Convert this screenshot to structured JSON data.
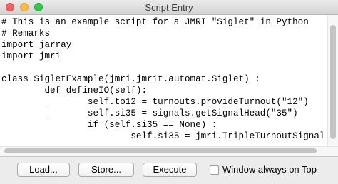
{
  "window": {
    "title": "Script Entry"
  },
  "editor": {
    "lines": [
      "# This is an example script for a JMRI \"Siglet\" in Python",
      "# Remarks",
      "import jarray",
      "import jmri",
      "",
      "class SigletExample(jmri.jmrit.automat.Siglet) :",
      "        def defineIO(self):",
      "                self.to12 = turnouts.provideTurnout(\"12\")",
      "                self.si35 = signals.getSignalHead(\"35\")",
      "                if (self.si35 == None) :",
      "                        self.si35 = jmri.TripleTurnoutSignal"
    ]
  },
  "buttons": {
    "load": "Load...",
    "store": "Store...",
    "execute": "Execute"
  },
  "options": {
    "window_always_on_top_label": "Window always on Top",
    "window_always_on_top_checked": false
  }
}
